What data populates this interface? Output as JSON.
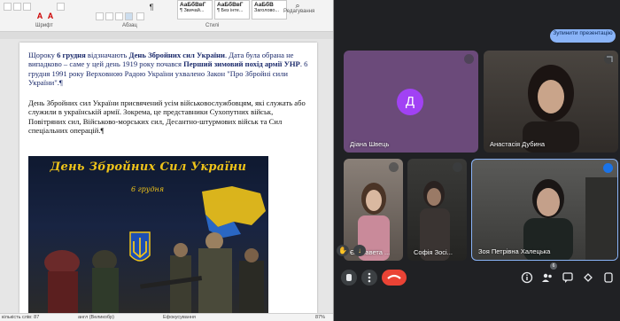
{
  "word": {
    "ribbon": {
      "group_font": "Шрифт",
      "group_paragraph": "Абзац",
      "group_styles": "Стилі",
      "group_editing": "Редагування",
      "styles": [
        {
          "preview": "АаБбВвГ",
          "name": "¶ Звичай..."
        },
        {
          "preview": "АаБбВвГ",
          "name": "¶ Без інте..."
        },
        {
          "preview": "АаБбВ",
          "name": "Заголово..."
        }
      ]
    },
    "document": {
      "para1_a": "Щороку ",
      "para1_b": "6 грудня",
      "para1_c": " відзначають ",
      "para1_d": "День Збройних сил України",
      "para1_e": ". Дата була обрана не випадково – саме у цей день 1919 року почався ",
      "para1_f": "Перший зимовий похід армії УНР",
      "para1_g": ". 6 грудня 1991 року Верховною Радою України ухвалено Закон \"Про Збройні сили України\".¶",
      "para2": "День Збройних сил України присвячений усім військовослужбовцям, які служать або служили в українській армії. Зокрема, це представники Сухопутних військ, Повітряних сил, Військово-морських сил, Десантно-штурмових військ та Сил спеціальних операцій.¶",
      "banner_title": "День Збройних Сил України",
      "banner_date": "6 грудня"
    },
    "status": {
      "word_count": "кількість слів: 87",
      "language": "англ (Великобр)",
      "focus": "Ефокусування",
      "zoom": "87%"
    }
  },
  "meet": {
    "present_button": "Зупинити презентацію",
    "participants": [
      {
        "name": "Діана Швець",
        "initial": "Д",
        "avatar_color": "#a142f4"
      },
      {
        "name": "Анастасія Дубина"
      },
      {
        "name": "Єлизавета ..."
      },
      {
        "name": "Софія Зосі..."
      },
      {
        "name": "Зоя Петрівна Халецька"
      }
    ],
    "people_count": "6",
    "colors": {
      "accent": "#8ab4f8",
      "leave": "#ea4335",
      "background": "#202124"
    }
  }
}
